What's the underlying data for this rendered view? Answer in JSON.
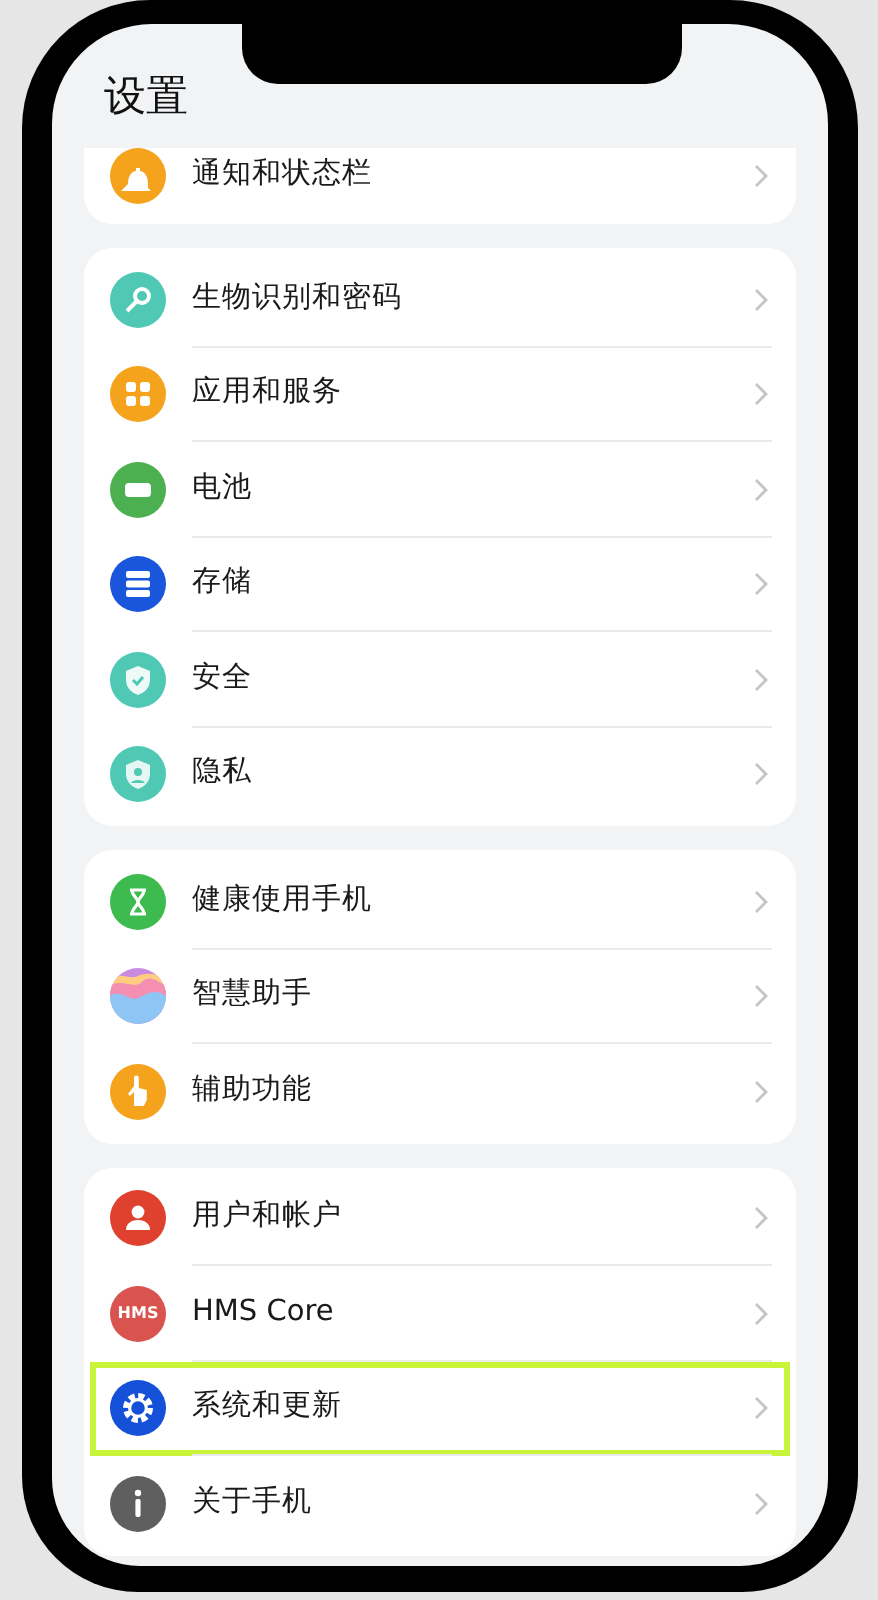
{
  "title": "设置",
  "groups": [
    {
      "partial": true,
      "items": [
        {
          "label": "通知和状态栏",
          "kind": "bell",
          "color": "#f5a31c",
          "highlighted": false
        }
      ]
    },
    {
      "partial": false,
      "items": [
        {
          "label": "生物识别和密码",
          "kind": "key",
          "color": "#4fc8b4",
          "highlighted": false
        },
        {
          "label": "应用和服务",
          "kind": "apps",
          "color": "#f5a31c",
          "highlighted": false
        },
        {
          "label": "电池",
          "kind": "battery",
          "color": "#4caf50",
          "highlighted": false
        },
        {
          "label": "存储",
          "kind": "storage",
          "color": "#1a56db",
          "highlighted": false
        },
        {
          "label": "安全",
          "kind": "shield",
          "color": "#4fc8b4",
          "highlighted": false
        },
        {
          "label": "隐私",
          "kind": "privacy",
          "color": "#4fc8b4",
          "highlighted": false
        }
      ]
    },
    {
      "partial": false,
      "items": [
        {
          "label": "健康使用手机",
          "kind": "hourglass",
          "color": "#3dbb4e",
          "highlighted": false
        },
        {
          "label": "智慧助手",
          "kind": "assistant",
          "color": "#c98be0",
          "highlighted": false
        },
        {
          "label": "辅助功能",
          "kind": "hand",
          "color": "#f5a31c",
          "highlighted": false
        }
      ]
    },
    {
      "partial": false,
      "items": [
        {
          "label": "用户和帐户",
          "kind": "user",
          "color": "#e0412f",
          "highlighted": false
        },
        {
          "label": "HMS Core",
          "kind": "hms",
          "icon_text": "HMS",
          "color": "#d9534f",
          "highlighted": false
        },
        {
          "label": "系统和更新",
          "kind": "gear",
          "color": "#1450d8",
          "highlighted": true
        },
        {
          "label": "关于手机",
          "kind": "info",
          "color": "#5f5f5f",
          "highlighted": false
        }
      ]
    }
  ]
}
